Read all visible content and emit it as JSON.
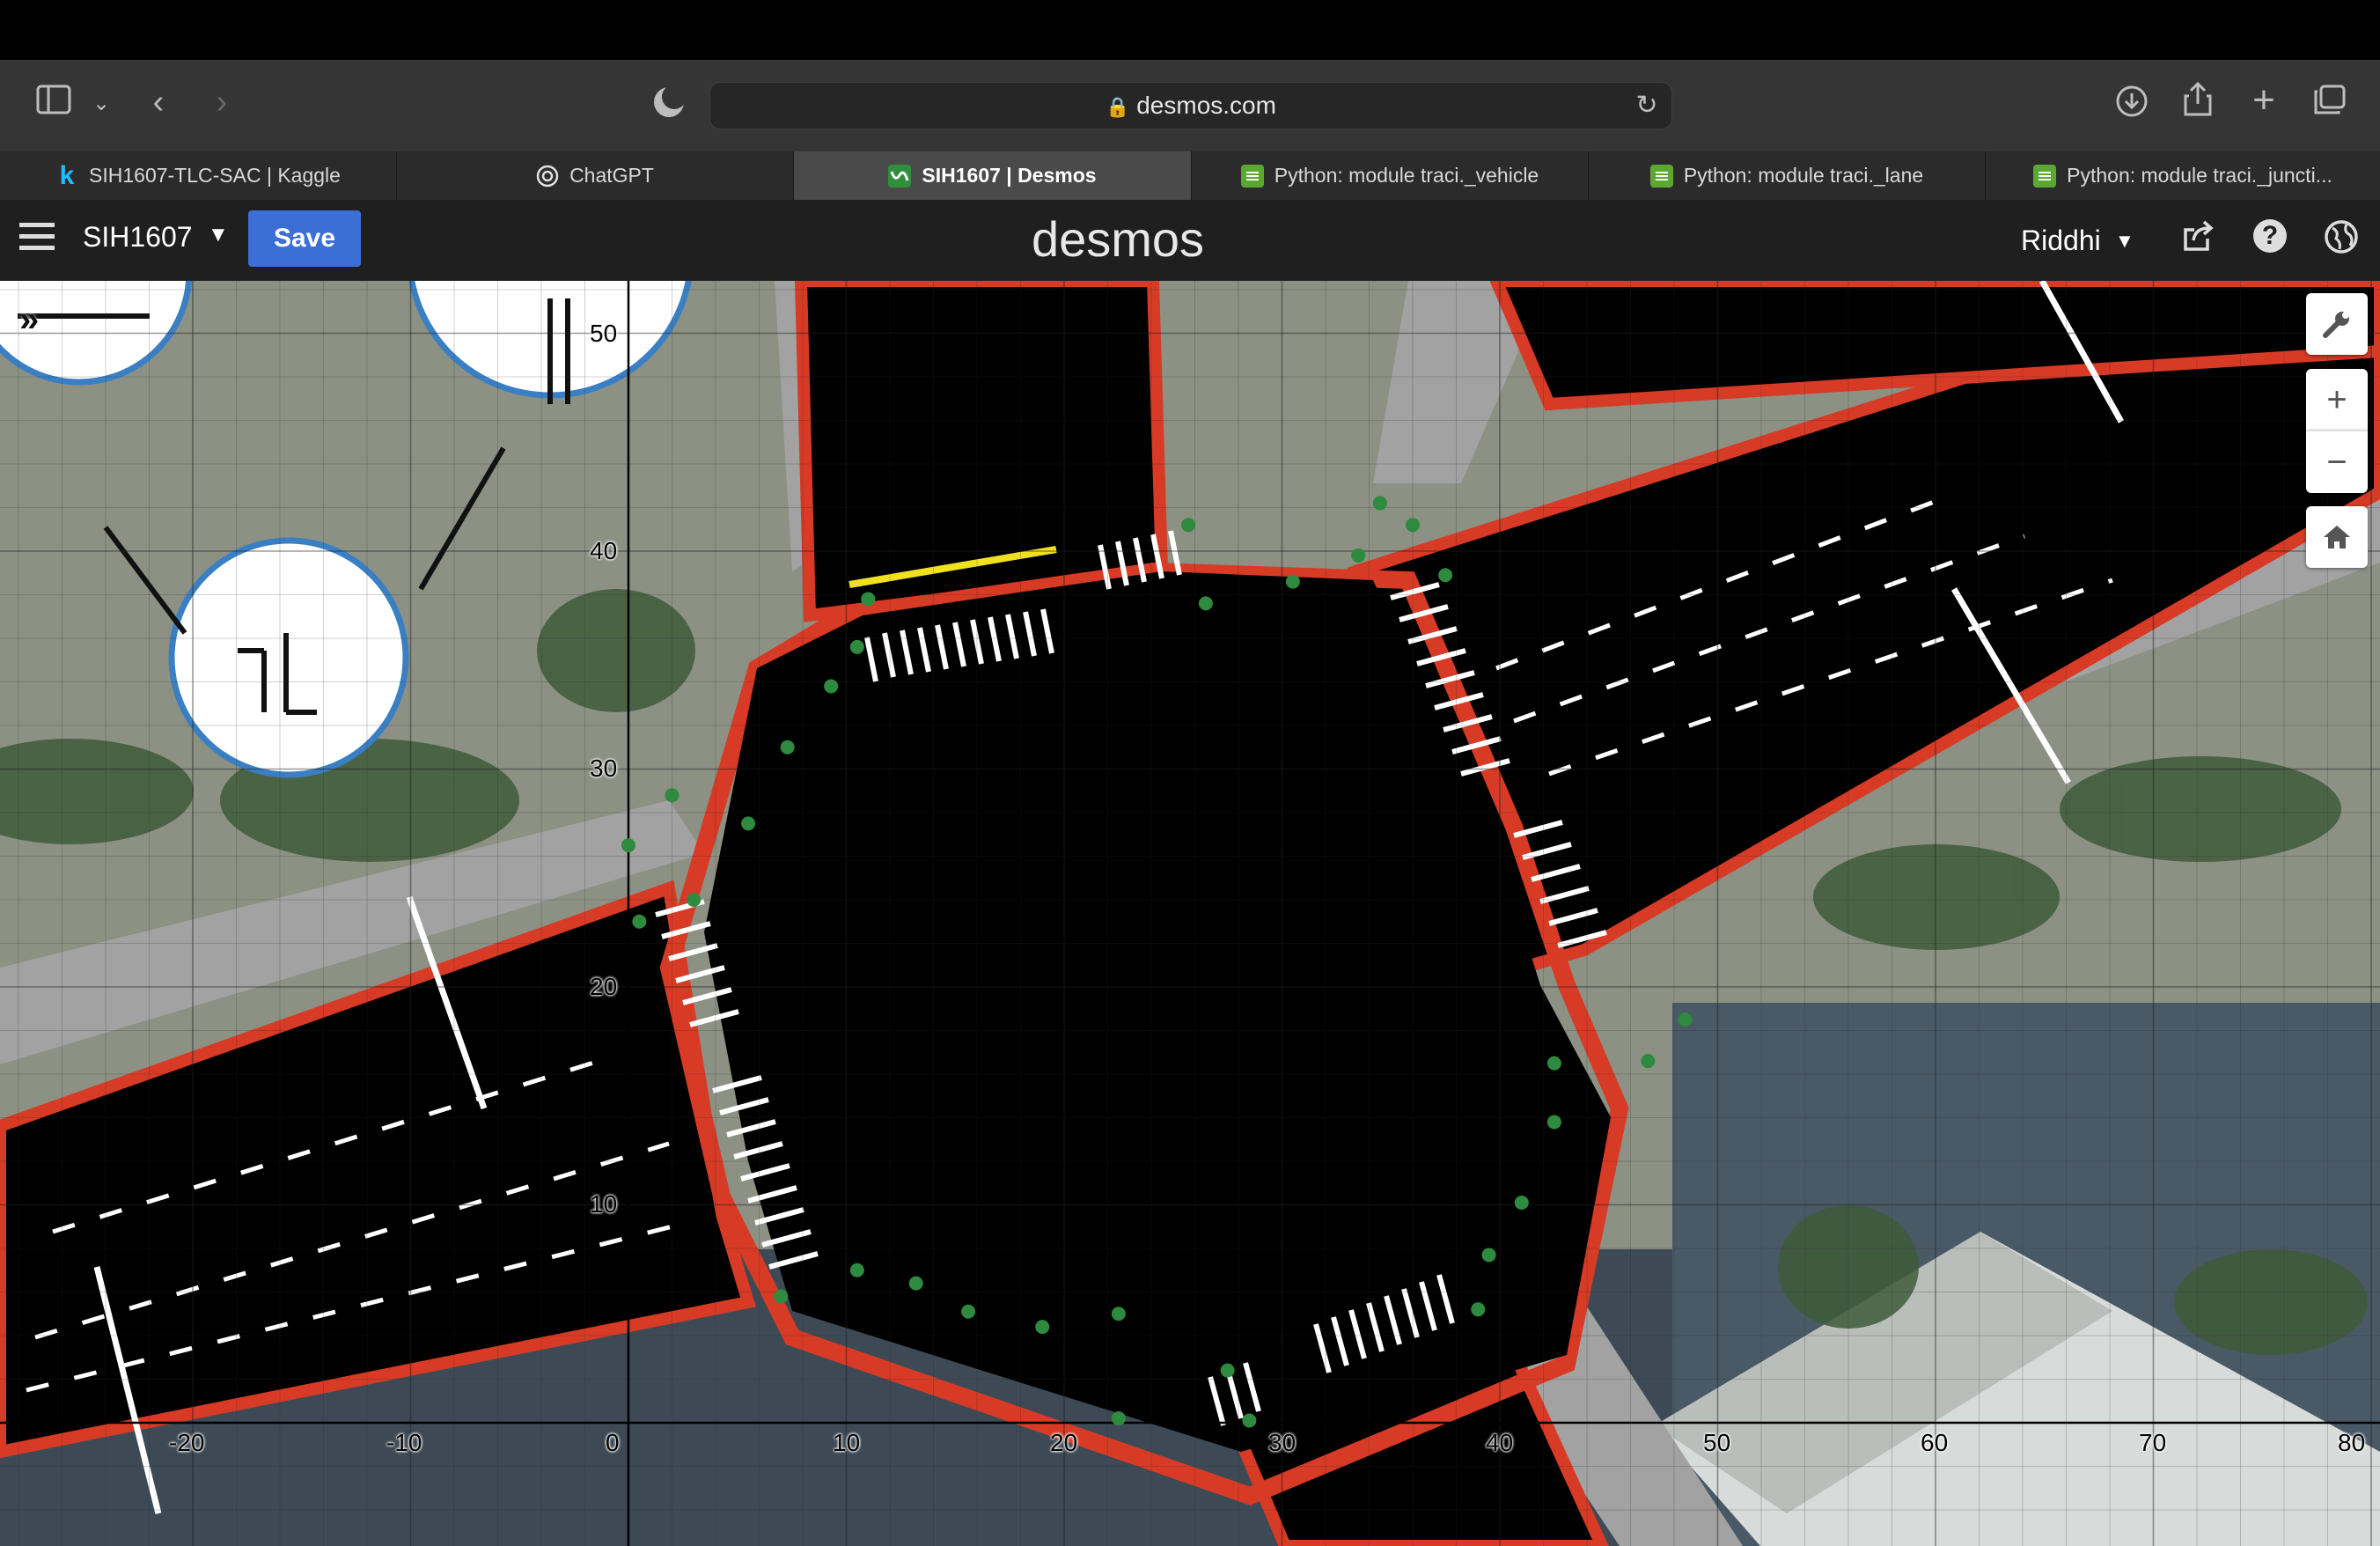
{
  "browser": {
    "url": "desmos.com",
    "tabs": [
      {
        "label": "SIH1607-TLC-SAC | Kaggle",
        "icon": "k"
      },
      {
        "label": "ChatGPT",
        "icon": "chatgpt"
      },
      {
        "label": "SIH1607 | Desmos",
        "icon": "desmos"
      },
      {
        "label": "Python: module traci._vehicle",
        "icon": "python"
      },
      {
        "label": "Python: module traci._lane",
        "icon": "python"
      },
      {
        "label": "Python: module traci._juncti...",
        "icon": "python"
      }
    ]
  },
  "desmos": {
    "graph_title": "SIH1607",
    "save_label": "Save",
    "logo": "desmos",
    "user": "Riddhi"
  },
  "graph": {
    "x_ticks": [
      "-20",
      "-10",
      "0",
      "10",
      "20",
      "30",
      "40",
      "50",
      "60",
      "70",
      "80"
    ],
    "y_ticks": [
      "10",
      "20",
      "30",
      "40",
      "50"
    ],
    "points": [
      [
        0,
        26.5
      ],
      [
        2,
        28.8
      ],
      [
        5.5,
        27.5
      ],
      [
        7.3,
        31
      ],
      [
        9.3,
        33.8
      ],
      [
        10.5,
        35.6
      ],
      [
        11,
        37.8
      ],
      [
        0.5,
        23
      ],
      [
        3,
        24
      ],
      [
        25.7,
        41.2
      ],
      [
        26.5,
        37.6
      ],
      [
        30.5,
        38.6
      ],
      [
        33.5,
        39.8
      ],
      [
        34.5,
        42.2
      ],
      [
        36,
        41.2
      ],
      [
        37.5,
        38.9
      ],
      [
        48.5,
        18.5
      ],
      [
        46.8,
        16.6
      ],
      [
        42.5,
        16.5
      ],
      [
        42.5,
        13.8
      ],
      [
        41,
        10.1
      ],
      [
        39.5,
        7.7
      ],
      [
        39,
        5.2
      ],
      [
        7,
        5.8
      ],
      [
        10.5,
        7
      ],
      [
        13.2,
        6.4
      ],
      [
        15.6,
        5.1
      ],
      [
        19,
        4.4
      ],
      [
        22.5,
        5
      ],
      [
        22.5,
        0.2
      ],
      [
        27.5,
        2.4
      ],
      [
        28.5,
        0.1
      ]
    ],
    "colors": {
      "point": "#2d8a3e",
      "curb": "#d73a25",
      "sidewalk": "#9a9a9a",
      "road": "#000000"
    }
  }
}
